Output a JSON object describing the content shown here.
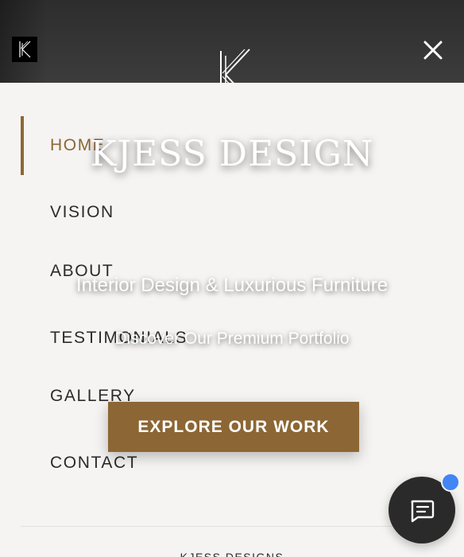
{
  "header": {
    "small_logo_icon": "kjess-monogram-icon",
    "center_logo_icon": "kjess-monogram-icon",
    "close_icon": "close-icon"
  },
  "menu": {
    "items": [
      {
        "label": "HOME",
        "active": true
      },
      {
        "label": "VISION",
        "active": false
      },
      {
        "label": "ABOUT",
        "active": false
      },
      {
        "label": "TESTIMONIALS",
        "active": false
      },
      {
        "label": "GALLERY",
        "active": false
      },
      {
        "label": "CONTACT",
        "active": false
      }
    ]
  },
  "hero": {
    "title": "KJESS DESIGN",
    "subtitle": "Interior Design & Luxurious Furniture",
    "tagline": "Discover Our Premium Portfolio",
    "cta_label": "EXPLORE OUR WORK"
  },
  "footer": {
    "brand": "KJESS DESIGNS"
  },
  "chat": {
    "icon": "chat-icon",
    "notification": true
  },
  "colors": {
    "accent": "#8c6634",
    "header_bg": "#333333",
    "panel_bg": "#f5f4f2",
    "notification": "#4285f4"
  }
}
